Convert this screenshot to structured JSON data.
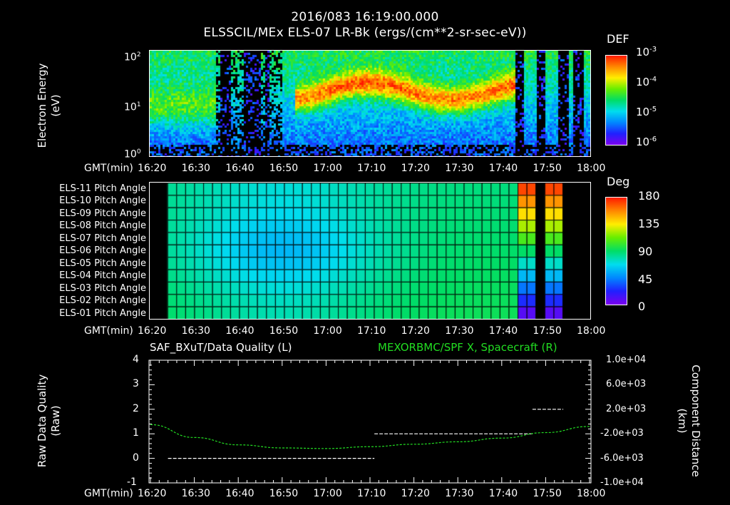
{
  "header": {
    "timestamp": "2016/083 16:19:00.000",
    "title": "ELSSCIL/MEx ELS-07 LR-Bk  (ergs/(cm**2-sr-sec-eV))"
  },
  "time_axis": {
    "label": "GMT(min)",
    "ticks": [
      "16:20",
      "16:30",
      "16:40",
      "16:50",
      "17:00",
      "17:10",
      "17:20",
      "17:30",
      "17:40",
      "17:50",
      "18:00"
    ]
  },
  "panel1": {
    "ylabel_line1": "Electron Energy",
    "ylabel_line2": "(eV)",
    "yticks": [
      {
        "base": "10",
        "exp": "2"
      },
      {
        "base": "10",
        "exp": "1"
      },
      {
        "base": "10",
        "exp": "0"
      }
    ],
    "colorbar": {
      "title": "DEF",
      "ticks": [
        {
          "base": "10",
          "exp": "-3"
        },
        {
          "base": "10",
          "exp": "-4"
        },
        {
          "base": "10",
          "exp": "-5"
        },
        {
          "base": "10",
          "exp": "-6"
        }
      ]
    }
  },
  "panel2": {
    "rows": [
      "ELS-11 Pitch Angle",
      "ELS-10 Pitch Angle",
      "ELS-09 Pitch Angle",
      "ELS-08 Pitch Angle",
      "ELS-07 Pitch Angle",
      "ELS-06 Pitch Angle",
      "ELS-05 Pitch Angle",
      "ELS-04 Pitch Angle",
      "ELS-03 Pitch Angle",
      "ELS-02 Pitch Angle",
      "ELS-01 Pitch Angle"
    ],
    "colorbar": {
      "title": "Deg",
      "ticks": [
        "180",
        "135",
        "90",
        "45",
        "0"
      ]
    }
  },
  "panel3": {
    "left_title": "SAF_BXuT/Data Quality (L)",
    "right_title": "MEXORBMC/SPF X, Spacecraft (R)",
    "ylabel_left_line1": "Raw Data Quality",
    "ylabel_left_line2": "(Raw)",
    "ylabel_right_line1": "Component Distance",
    "ylabel_right_line2": "(km)",
    "left_ticks": [
      "4",
      "3",
      "2",
      "1",
      "0",
      "-1"
    ],
    "right_ticks": [
      "1.0e+04",
      "6.0e+03",
      "2.0e+03",
      "-2.0e+03",
      "-6.0e+03",
      "-1.0e+04"
    ]
  },
  "chart_data": [
    {
      "type": "heatmap",
      "title": "ELSSCIL/MEx ELS-07 LR-Bk  (ergs/(cm**2-sr-sec-eV))",
      "xlabel": "GMT(min)",
      "ylabel": "Electron Energy (eV)",
      "x_range": [
        "16:20",
        "18:00"
      ],
      "y_range": [
        1,
        150
      ],
      "y_scale": "log",
      "colorbar": {
        "label": "DEF",
        "range": [
          1e-06,
          0.001
        ],
        "scale": "log"
      }
    },
    {
      "type": "heatmap",
      "xlabel": "GMT(min)",
      "x_range": [
        "16:20",
        "18:00"
      ],
      "rows": [
        "ELS-11",
        "ELS-10",
        "ELS-09",
        "ELS-08",
        "ELS-07",
        "ELS-06",
        "ELS-05",
        "ELS-04",
        "ELS-03",
        "ELS-02",
        "ELS-01"
      ],
      "colorbar": {
        "label": "Deg",
        "range": [
          0,
          180
        ]
      }
    },
    {
      "type": "line",
      "xlabel": "GMT(min)",
      "x_range": [
        "16:20",
        "18:00"
      ],
      "ylim_left": [
        -1,
        4
      ],
      "ylim_right": [
        -10000,
        10000
      ],
      "series": [
        {
          "name": "SAF_BXuT/Data Quality (L)",
          "axis": "left",
          "color": "#ffffff",
          "segments": [
            {
              "x": [
                "16:24",
                "17:11"
              ],
              "y": 0
            },
            {
              "x": [
                "17:11",
                "17:47"
              ],
              "y": 1
            },
            {
              "x": [
                "17:47",
                "17:54"
              ],
              "y": 2
            }
          ]
        },
        {
          "name": "MEXORBMC/SPF X, Spacecraft (R)",
          "axis": "right",
          "color": "#22dd22",
          "x": [
            "16:20",
            "16:30",
            "16:40",
            "16:50",
            "17:00",
            "17:10",
            "17:20",
            "17:30",
            "17:40",
            "17:50",
            "18:00"
          ],
          "y": [
            -500,
            -2600,
            -3800,
            -4300,
            -4400,
            -4100,
            -3700,
            -3300,
            -2700,
            -1800,
            -800
          ]
        }
      ]
    }
  ]
}
